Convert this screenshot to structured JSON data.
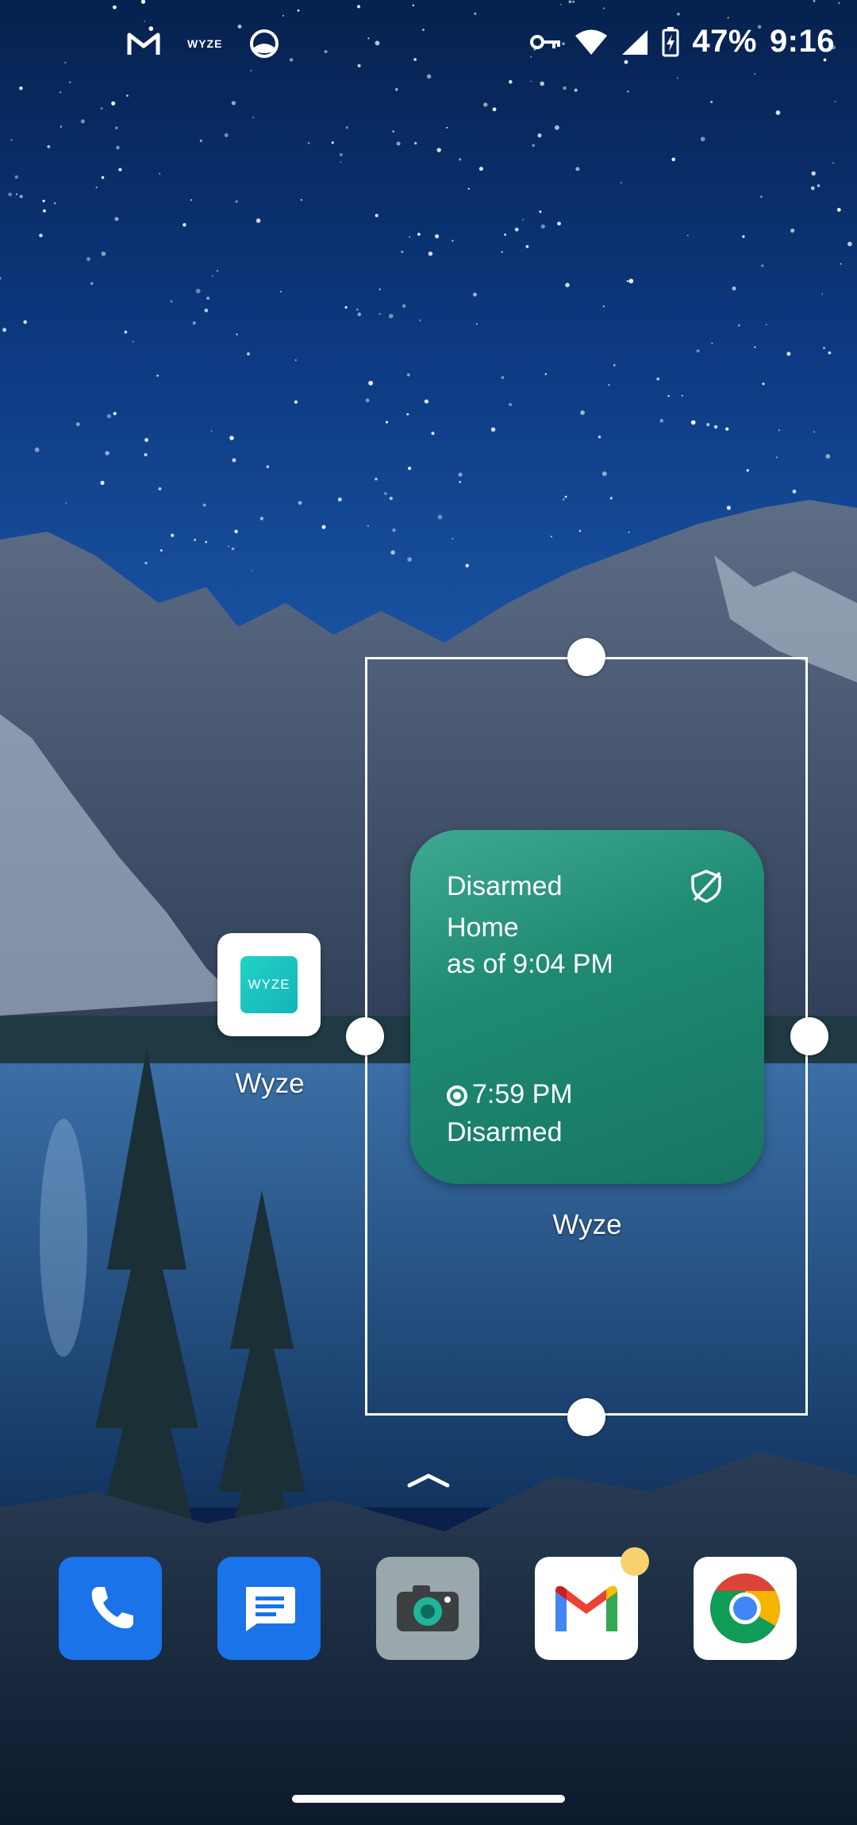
{
  "status_bar": {
    "left_icons": [
      "gmail-icon",
      "wyze-icon",
      "browser-icon"
    ],
    "wyze_mini_text": "WYZE",
    "right_icons": [
      "vpn-key-icon",
      "wifi-icon",
      "cell-signal-icon",
      "battery-charging-icon"
    ],
    "battery": "47%",
    "time": "9:16"
  },
  "desktop": {
    "wyze_app": {
      "label": "Wyze",
      "icon_text": "WYZE"
    }
  },
  "widget": {
    "status": "Disarmed",
    "mode": "Home",
    "as_of": "as of 9:04 PM",
    "event_time": "7:59 PM",
    "event_status": "Disarmed",
    "label": "Wyze",
    "colors": {
      "top": "#3fa892",
      "bottom": "#167563"
    }
  },
  "dock": {
    "apps": [
      "phone-icon",
      "messages-icon",
      "camera-icon",
      "gmail-icon",
      "chrome-icon"
    ],
    "gmail_notification": true
  }
}
